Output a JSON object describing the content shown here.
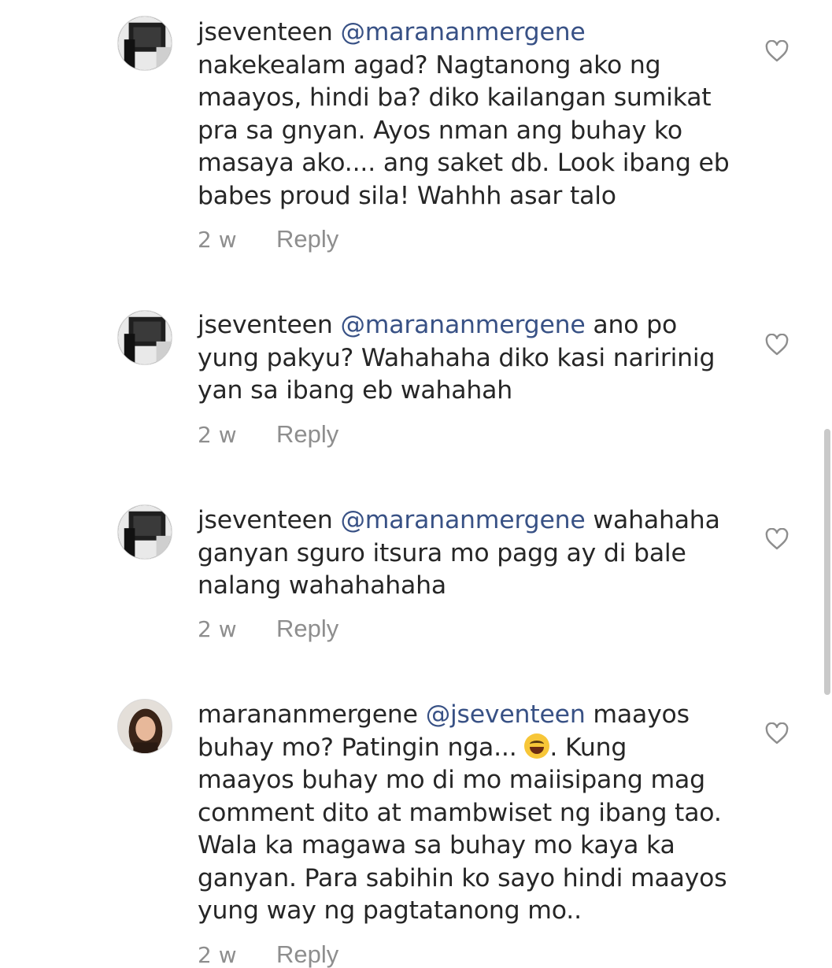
{
  "comments": [
    {
      "username": "jseventeen",
      "mention": "@marananmergene",
      "lines": [
        "",
        "nakekealam agad? Nagtanong ako ng",
        "maayos, hindi ba? diko kailangan sumikat",
        "pra sa gnyan. Ayos nman ang buhay ko",
        "masaya ako.... ang saket db. Look ibang eb",
        "babes proud sila! Wahhh asar talo"
      ],
      "time": "2 w",
      "reply": "Reply",
      "avatar": "halloween-sign-avatar"
    },
    {
      "username": "jseventeen",
      "mention": "@marananmergene",
      "lines": [
        " ano po",
        "yung pakyu? Wahahaha diko kasi naririnig",
        "yan sa ibang eb wahahah"
      ],
      "time": "2 w",
      "reply": "Reply",
      "avatar": "halloween-sign-avatar"
    },
    {
      "username": "jseventeen",
      "mention": "@marananmergene",
      "lines": [
        " wahahaha",
        "ganyan sguro itsura mo pagg ay di bale",
        "nalang wahahahaha"
      ],
      "time": "2 w",
      "reply": "Reply",
      "avatar": "halloween-sign-avatar"
    },
    {
      "username": "marananmergene",
      "mention": "@jseventeen",
      "lines": [
        " maayos",
        "buhay mo? Patingin nga... ",
        ". Kung",
        "maayos buhay mo di mo maiisipang mag",
        "comment dito at mambwiset ng ibang tao.",
        "Wala ka magawa sa buhay mo kaya ka",
        "ganyan. Para sabihin ko sayo hindi maayos",
        "yung way ng pagtatanong mo.."
      ],
      "emoji": "face-with-tears-of-joy",
      "time": "2 w",
      "reply": "Reply",
      "avatar": "girl-portrait-avatar"
    }
  ],
  "icons": {
    "like": "heart-outline-icon"
  },
  "colors": {
    "text": "#262626",
    "mention": "#385185",
    "meta": "#8e8e8e"
  }
}
